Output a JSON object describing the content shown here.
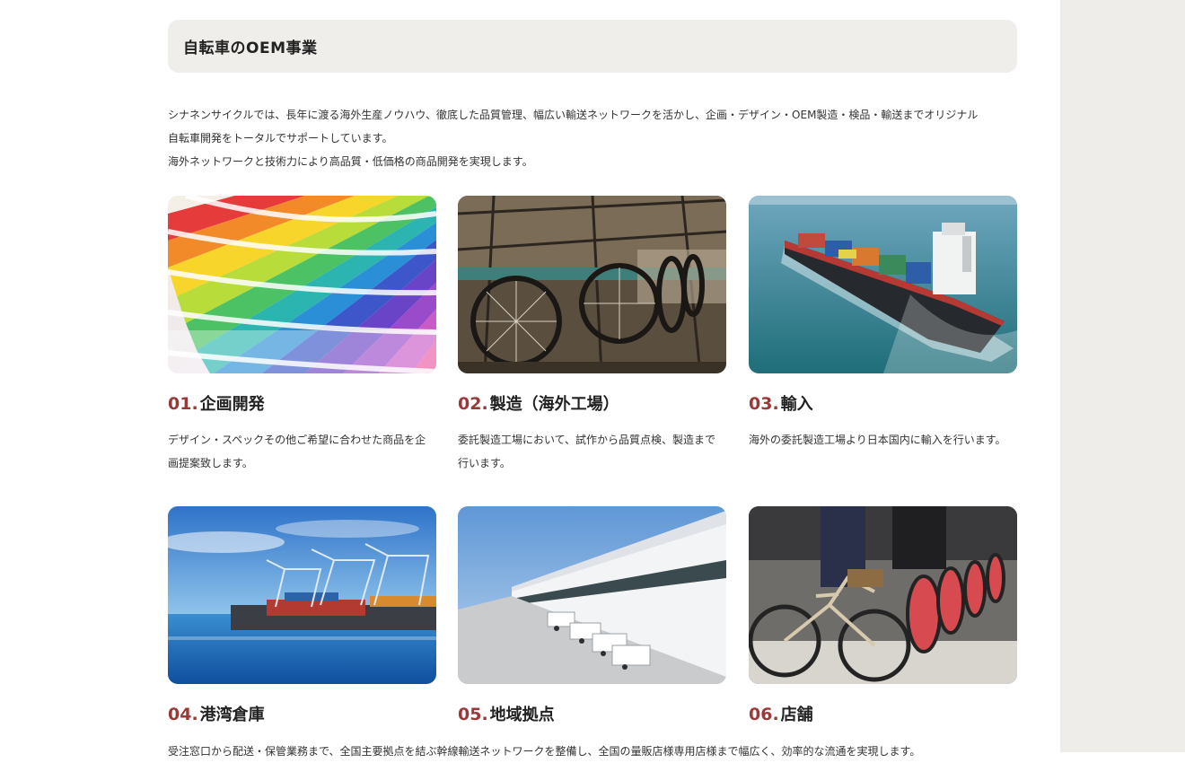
{
  "section": {
    "title": "自転車のOEM事業",
    "intro": [
      "シナネンサイクルでは、長年に渡る海外生産ノウハウ、徹底した品質管理、幅広い輸送ネットワークを活かし、企画・デザイン・OEM製造・検品・輸送までオリジナル",
      "自転車開発をトータルでサポートしています。",
      "海外ネットワークと技術力により高品質・低価格の商品開発を実現します。"
    ]
  },
  "services": [
    {
      "num": "01.",
      "title": "企画開発",
      "desc": "デザイン・スペックその他ご希望に合わせた商品を企画提案致します。",
      "image": "color-swatch-fan"
    },
    {
      "num": "02.",
      "title": "製造（海外工場）",
      "desc": "委託製造工場において、試作から品質点検、製造まで行います。",
      "image": "bicycle-factory-conveyor"
    },
    {
      "num": "03.",
      "title": "輸入",
      "desc": "海外の委託製造工場より日本国内に輸入を行います。",
      "image": "container-ship-at-sea"
    },
    {
      "num": "04.",
      "title": "港湾倉庫",
      "desc": "",
      "image": "container-port-cranes"
    },
    {
      "num": "05.",
      "title": "地域拠点",
      "desc": "",
      "image": "warehouse-with-trucks"
    },
    {
      "num": "06.",
      "title": "店舗",
      "desc": "",
      "image": "bicycle-store-display"
    }
  ],
  "bottom_text": "受注窓口から配送・保管業務まで、全国主要拠点を結ぶ幹線輸送ネットワークを整備し、全国の量販店様専用店様まで幅広く、効率的な流通を実現します。",
  "colors": {
    "accent_number": "#9a3a38",
    "heading_bg": "#efeeea",
    "side_panel": "#eeede9"
  }
}
